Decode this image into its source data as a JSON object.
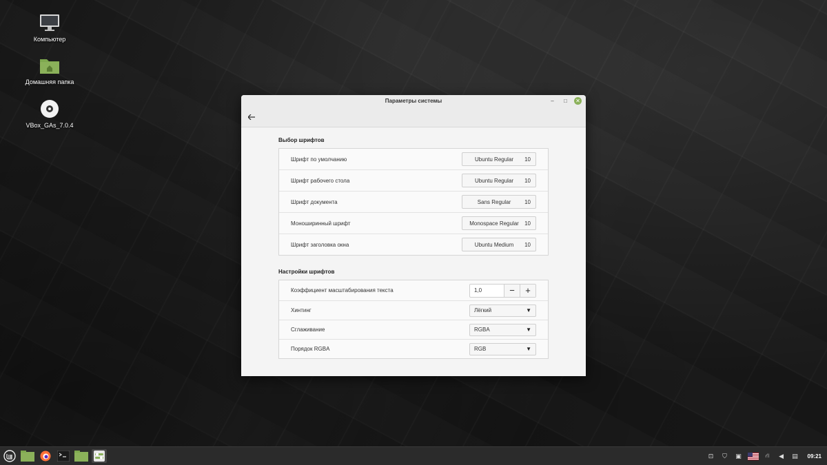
{
  "desktop": {
    "icons": [
      {
        "name": "computer-icon",
        "label": "Компьютер"
      },
      {
        "name": "home-folder-icon",
        "label": "Домашняя папка"
      },
      {
        "name": "disc-icon",
        "label": "VBox_GAs_7.0.4"
      }
    ]
  },
  "window": {
    "title": "Параметры системы",
    "fonts_section": {
      "title": "Выбор шрифтов",
      "rows": [
        {
          "label": "Шрифт по умолчанию",
          "font": "Ubuntu Regular",
          "size": "10"
        },
        {
          "label": "Шрифт рабочего стола",
          "font": "Ubuntu Regular",
          "size": "10"
        },
        {
          "label": "Шрифт документа",
          "font": "Sans Regular",
          "size": "10"
        },
        {
          "label": "Моноширинный шрифт",
          "font": "Monospace Regular",
          "size": "10"
        },
        {
          "label": "Шрифт заголовка окна",
          "font": "Ubuntu Medium",
          "size": "10"
        }
      ]
    },
    "settings_section": {
      "title": "Настройки шрифтов",
      "scale": {
        "label": "Коэффициент масштабирования текста",
        "value": "1,0",
        "minus": "−",
        "plus": "+"
      },
      "hinting": {
        "label": "Хинтинг",
        "value": "Лёгкий"
      },
      "antialiasing": {
        "label": "Сглаживание",
        "value": "RGBA"
      },
      "rgba_order": {
        "label": "Порядок RGBA",
        "value": "RGB"
      }
    }
  },
  "taskbar": {
    "clock": "09:21",
    "accent": "#8bb15a"
  }
}
